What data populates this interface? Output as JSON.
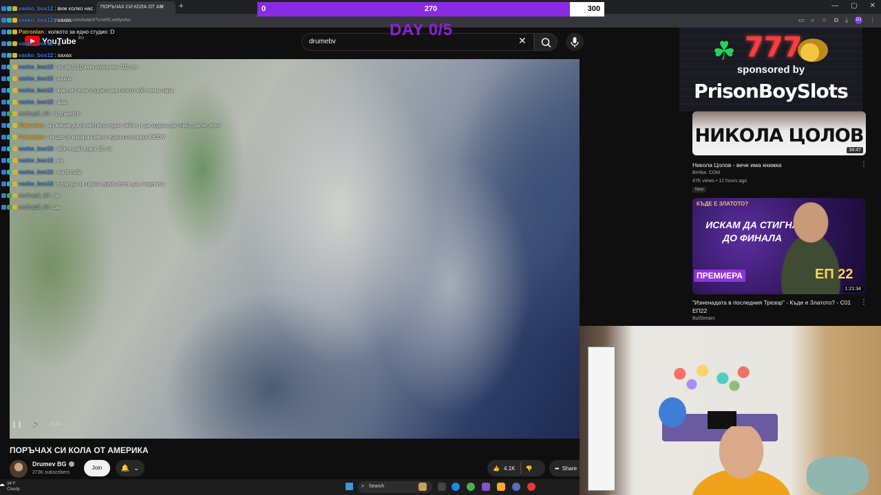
{
  "browser": {
    "tab_title": "ПОРЪЧАХ СИ КОЛА ОТ АМ",
    "tab_close": "✕",
    "new_tab": "+",
    "url": "youtube.com/watch?v=eRLve8ynAs",
    "profile_initials": "DJ",
    "window_controls": [
      "—",
      "▢",
      "✕"
    ]
  },
  "youtube": {
    "logo_text": "YouTube",
    "logo_country": "BG",
    "search_query": "drumebv",
    "search_clear": "✕"
  },
  "overlay": {
    "goal_start": "0",
    "goal_current": "270",
    "goal_end": "300",
    "goal_fraction": 0.9,
    "day_counter": "DAY 0/5"
  },
  "chat": [
    {
      "user": "vasko_box12",
      "color": "#3e7ad9",
      "text": "виж колко нас"
    },
    {
      "user": "vasko_box12",
      "color": "#3e7ad9",
      "text": "хахах"
    },
    {
      "user": "Patronlan",
      "color": "#e0b030",
      "text": "колкото за едно студио :D"
    },
    {
      "user": "vasko_box12",
      "color": "#3e7ad9",
      "text": "а"
    },
    {
      "user": "vasko_box12",
      "color": "#3e7ad9",
      "text": "хахах"
    },
    {
      "user": "vasko_box12",
      "color": "#3e7ad9",
      "text": "аз за 5-10 мин изхарчих 100 лв"
    },
    {
      "user": "vasko_box12",
      "color": "#3e7ad9",
      "text": "хахах"
    },
    {
      "user": "vasko_box12",
      "color": "#3e7ad9",
      "text": "как ли ти на сторито на гопето кой нема пари"
    },
    {
      "user": "vasko_box12",
      "color": "#3e7ad9",
      "text": "ааа"
    },
    {
      "user": "mcfrap3_44",
      "color": "#9aa0a6",
      "text": "sl znaedsh"
    },
    {
      "user": "Patronlan",
      "color": "#e0b030",
      "text": "аз викам да си метнеш едно чайче и да ходиш да спиш, да не звън"
    },
    {
      "user": "Patronlan",
      "color": "#e0b030",
      "text": "че ще те изкара само с една плесница KKEW"
    },
    {
      "user": "vasko_box12",
      "color": "#3e7ad9",
      "text": "абе я дай една 12-ла"
    },
    {
      "user": "vasko_box12",
      "color": "#3e7ad9",
      "text": "ха"
    },
    {
      "user": "vasko_box12",
      "color": "#3e7ad9",
      "text": "на 8 съба"
    },
    {
      "user": "vasko_box12",
      "color": "#3e7ad9",
      "text": "седи да ти прата една песен да я оцениш"
    },
    {
      "user": "mcfrap3_44",
      "color": "#9aa0a6",
      "text": "da"
    },
    {
      "user": "mcfrap3_44",
      "color": "#9aa0a6",
      "text": "da"
    }
  ],
  "video": {
    "title": "ПОРЪЧАХ СИ КОЛА ОТ АМЕРИКА",
    "channel": "Drumev BG",
    "subscribers": "273K subscribers",
    "join_label": "Join",
    "likes": "4.1K",
    "share_label": "Share",
    "player_time": "0:24"
  },
  "sponsor": {
    "number": "777",
    "line1": "sponsored by",
    "line2": "PrisonBoySlots"
  },
  "recommendations": [
    {
      "thumb_text": "НИКОЛА ЦОЛОВ",
      "duration": "34:47",
      "title": "Никола Цолов - вече има книжка",
      "channel": "Bri4ka. COM",
      "meta": "47K views • 12 hours ago",
      "badge": "New"
    },
    {
      "thumb_tag": "КЪДЕ Е ЗЛАТОТО?",
      "thumb_headline": "ИСКАМ ДА СТИГНА ДО ФИНАЛА",
      "thumb_premiere": "ПРЕМИЕРА",
      "thumb_ep": "ЕП 22",
      "duration": "1:21:34",
      "title": "\"Изненадата в последния Трезор\" - Къде е Златото? - С01 ЕП22",
      "channel": "BulStream"
    }
  ],
  "taskbar": {
    "temperature": "34°F",
    "weather": "Cloudy",
    "search_label": "Search"
  }
}
